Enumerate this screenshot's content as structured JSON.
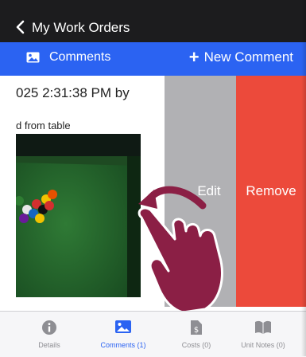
{
  "nav": {
    "back_icon": "chevron-left-icon",
    "title": "My Work Orders"
  },
  "action_bar": {
    "comments_icon": "photo-icon",
    "comments_label": "Comments",
    "new_comment_label": "New Comment",
    "new_comment_icon": "plus-icon"
  },
  "comment": {
    "date_text": "025 2:31:38 PM by",
    "body_text": "d from table",
    "image_desc_icon": "photo-thumbnail"
  },
  "swipe_actions": {
    "edit_label": "Edit",
    "remove_label": "Remove",
    "edit_color": "#b1b1b4",
    "remove_color": "#ec4a3b"
  },
  "gesture": {
    "hand_icon": "swipe-hand-icon",
    "arrow_icon": "curved-arrow-left-icon",
    "color": "#8b1f45"
  },
  "tab_bar": {
    "tabs": [
      {
        "label": "Details",
        "icon": "info-icon",
        "active": false
      },
      {
        "label": "Comments (1)",
        "icon": "photo-icon",
        "active": true
      },
      {
        "label": "Costs (0)",
        "icon": "dollar-document-icon",
        "active": false
      },
      {
        "label": "Unit Notes (0)",
        "icon": "book-icon",
        "active": false
      }
    ],
    "active_color": "#2b63f2"
  },
  "colors": {
    "nav_bg": "#1c1c1e",
    "action_bar_bg": "#2b63f2"
  }
}
